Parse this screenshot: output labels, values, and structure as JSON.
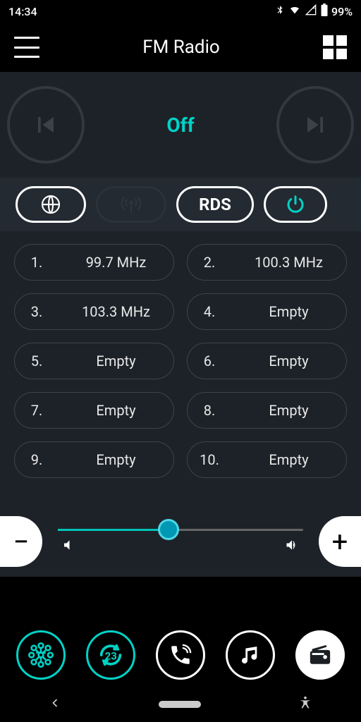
{
  "status": {
    "time": "14:34",
    "battery": "99%"
  },
  "title": "FM Radio",
  "state": "Off",
  "modes": {
    "rds_label": "RDS"
  },
  "presets": [
    {
      "num": "1.",
      "val": "99.7 MHz"
    },
    {
      "num": "2.",
      "val": "100.3 MHz"
    },
    {
      "num": "3.",
      "val": "103.3 MHz"
    },
    {
      "num": "4.",
      "val": "Empty"
    },
    {
      "num": "5.",
      "val": "Empty"
    },
    {
      "num": "6.",
      "val": "Empty"
    },
    {
      "num": "7.",
      "val": "Empty"
    },
    {
      "num": "8.",
      "val": "Empty"
    },
    {
      "num": "9.",
      "val": "Empty"
    },
    {
      "num": "10.",
      "val": "Empty"
    }
  ],
  "volume": {
    "percent": 45
  },
  "colors": {
    "accent": "#00d2c6",
    "bg_panel": "#1d2228"
  }
}
